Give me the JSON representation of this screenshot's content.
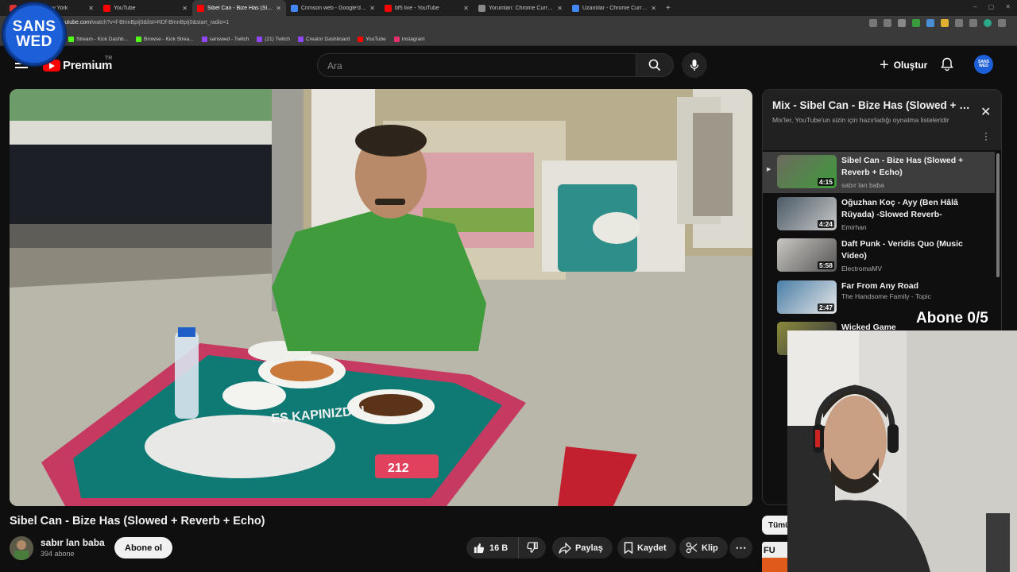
{
  "browser": {
    "tabs": [
      {
        "title": "chman In New York",
        "color": "#d33"
      },
      {
        "title": "YouTube",
        "color": "#f00"
      },
      {
        "title": "Sibel Can - Bize Has (Slowed",
        "color": "#f00",
        "active": true
      },
      {
        "title": "Crimson web - Google'da Ara",
        "color": "#4285f4"
      },
      {
        "title": "bf5 live - YouTube",
        "color": "#f00"
      },
      {
        "title": "Yorumları: Chrome Currency Co",
        "color": "#888"
      },
      {
        "title": "Uzantılar - Chrome Currency Co",
        "color": "#4285f4"
      }
    ],
    "new_tab": "+",
    "url_prefix": "youtube.com",
    "url_rest": "/watch?v=f-BInnBpIj0&list=RDf-BInnBpIj0&start_radio=1",
    "bookmarks": [
      {
        "label": "Stream - Kick Dashb...",
        "color": "#53fc18"
      },
      {
        "label": "Browse - Kick Strea...",
        "color": "#53fc18"
      },
      {
        "label": "sanswed - Twitch",
        "color": "#9146ff"
      },
      {
        "label": "(21) Twitch",
        "color": "#9146ff"
      },
      {
        "label": "Creator Dashboard",
        "color": "#9146ff"
      },
      {
        "label": "YouTube",
        "color": "#f00"
      },
      {
        "label": "Instagram",
        "color": "#e1306c"
      }
    ]
  },
  "logo": {
    "line1": "SANS",
    "line2": "WED"
  },
  "header": {
    "brand": "Premium",
    "country": "TR",
    "search_placeholder": "Ara",
    "create_label": "Oluştur",
    "avatar_line1": "SANS",
    "avatar_line2": "WED"
  },
  "video": {
    "title": "Sibel Can - Bize Has (Slowed + Reverb + Echo)",
    "channel": "sabır lan baba",
    "subscribers": "394 abone",
    "subscribe_label": "Abone ol",
    "likes": "16 B",
    "share_label": "Paylaş",
    "save_label": "Kaydet",
    "clip_label": "Klip",
    "more_label": "⋯",
    "scene_text": "ES KAPINIZDA!",
    "scene_num": "212"
  },
  "playlist": {
    "title": "Mix - Sibel Can - Bize Has (Slowed + Reverb + Echo)",
    "subtitle": "Mix'ler, YouTube'un sizin için hazırladığı oynatma listeleridir",
    "items": [
      {
        "title": "Sibel Can - Bize Has (Slowed + Reverb + Echo)",
        "channel": "sabır lan baba",
        "duration": "4:15",
        "current": true
      },
      {
        "title": "Oğuzhan Koç - Ayy (Ben Hâlâ Rüyada) -Slowed Reverb-",
        "channel": "Emirhan",
        "duration": "4:24"
      },
      {
        "title": "Daft Punk - Veridis Quo (Music Video)",
        "channel": "ElectromaMV",
        "duration": "5:58"
      },
      {
        "title": "Far From Any Road",
        "channel": "The Handsome Family - Topic",
        "duration": "2:47"
      },
      {
        "title": "Wicked Game",
        "channel": "",
        "duration": ""
      }
    ]
  },
  "overlay": {
    "sub_goal": "Abone 0/5"
  },
  "chips": {
    "all": "Tümü"
  }
}
